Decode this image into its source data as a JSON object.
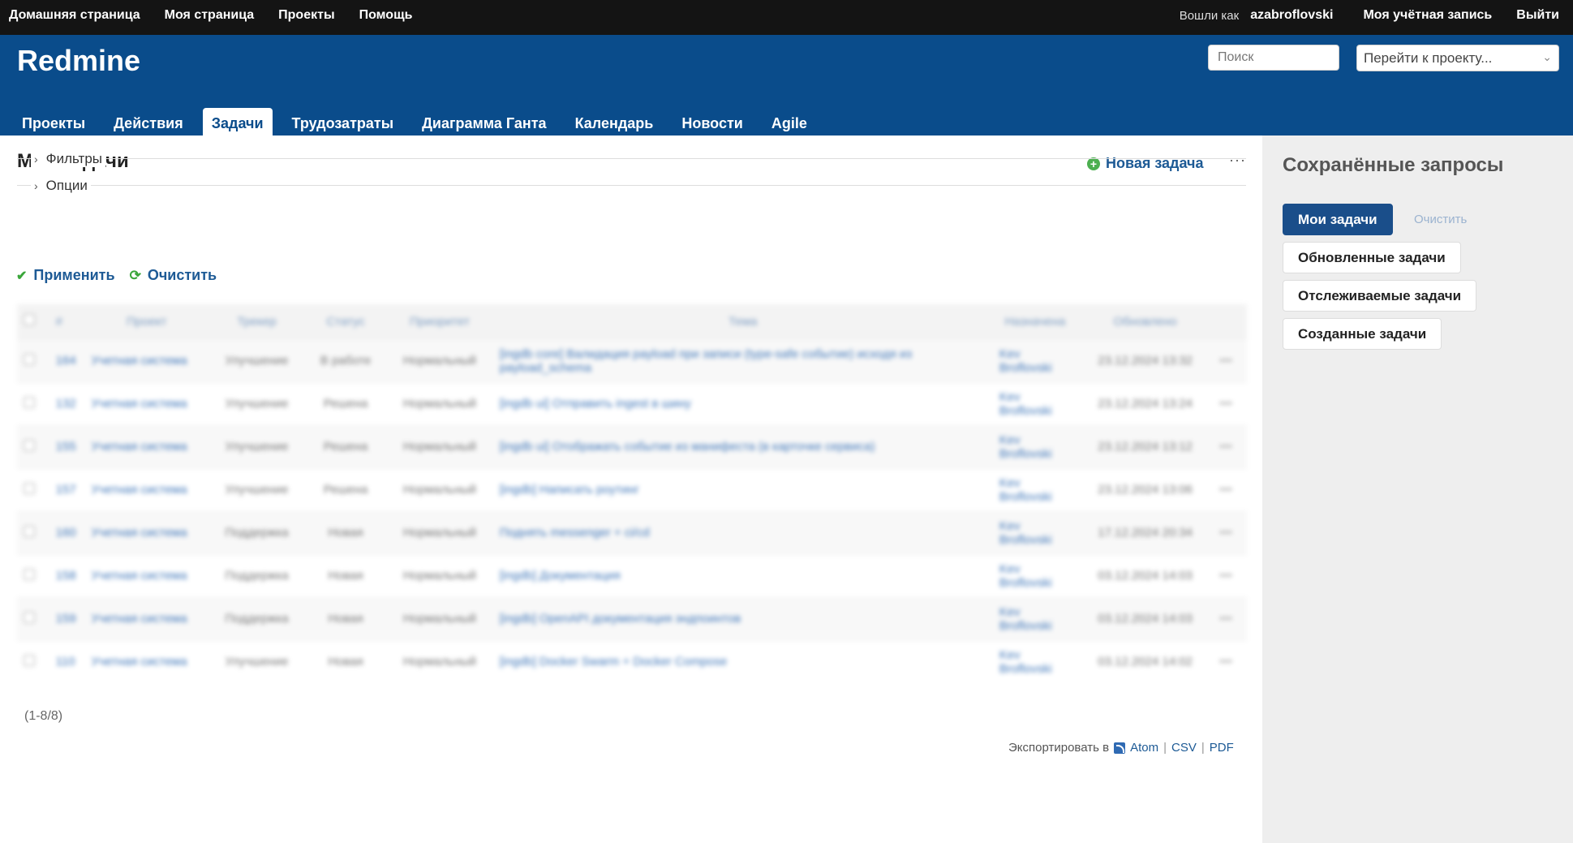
{
  "top_menu": {
    "left": [
      "Домашняя страница",
      "Моя страница",
      "Проекты",
      "Помощь"
    ],
    "logged_as": "Вошли как",
    "username": "azabroflovski",
    "account": "Моя учётная запись",
    "logout": "Выйти"
  },
  "header": {
    "title": "Redmine",
    "search_placeholder": "Поиск",
    "project_jump": "Перейти к проекту..."
  },
  "main_menu": {
    "tabs": [
      "Проекты",
      "Действия",
      "Задачи",
      "Трудозатраты",
      "Диаграмма Ганта",
      "Календарь",
      "Новости",
      "Agile"
    ],
    "selected": "Задачи"
  },
  "content": {
    "title": "Мои задачи",
    "new_issue": "Новая задача",
    "more": "···",
    "filters_label": "Фильтры",
    "options_label": "Опции",
    "apply": "Применить",
    "clear": "Очистить",
    "count": "(1-8/8)",
    "export_label": "Экспортировать в",
    "export_atom": "Atom",
    "export_csv": "CSV",
    "export_pdf": "PDF",
    "sep": "|"
  },
  "table": {
    "headers": [
      "#",
      "Проект",
      "Трекер",
      "Статус",
      "Приоритет",
      "Тема",
      "Назначена",
      "Обновлено"
    ],
    "rows": [
      [
        "164",
        "Учетная система",
        "Улучшение",
        "В работе",
        "Нормальный",
        "[ingdb core] Валидация payload при записи (type-safe событие) исходя из payload_schema",
        "Kev Broflovski",
        "23.12.2024 13:32"
      ],
      [
        "132",
        "Учетная система",
        "Улучшение",
        "Решена",
        "Нормальный",
        "[ingdb ui] Отправить ingest в шину",
        "Kev Broflovski",
        "23.12.2024 13:24"
      ],
      [
        "155",
        "Учетная система",
        "Улучшение",
        "Решена",
        "Нормальный",
        "[ingdb ui] Отображать событие из манифеста (в карточке сервиса)",
        "Kev Broflovski",
        "23.12.2024 13:12"
      ],
      [
        "157",
        "Учетная система",
        "Улучшение",
        "Решена",
        "Нормальный",
        "[ingdb] Написать роутинг",
        "Kev Broflovski",
        "23.12.2024 13:06"
      ],
      [
        "160",
        "Учетная система",
        "Поддержка",
        "Новая",
        "Нормальный",
        "Поднять messenger + ci/cd",
        "Kev Broflovski",
        "17.12.2024 20:34"
      ],
      [
        "158",
        "Учетная система",
        "Поддержка",
        "Новая",
        "Нормальный",
        "[ingdb] Документация",
        "Kev Broflovski",
        "03.12.2024 14:03"
      ],
      [
        "159",
        "Учетная система",
        "Поддержка",
        "Новая",
        "Нормальный",
        "[ingdb] OpenAPI документация эндпоинтов",
        "Kev Broflovski",
        "03.12.2024 14:03"
      ],
      [
        "110",
        "Учетная система",
        "Улучшение",
        "Новая",
        "Нормальный",
        "[ingdb] Docker Swarm + Docker Compose",
        "Kev Broflovski",
        "03.12.2024 14:02"
      ]
    ]
  },
  "sidebar": {
    "title": "Сохранённые запросы",
    "queries": [
      "Мои задачи",
      "Обновленные задачи",
      "Отслеживаемые задачи",
      "Созданные задачи"
    ],
    "selected": "Мои задачи",
    "clear": "Очистить"
  },
  "colors": {
    "header_bg": "#0a4c8b",
    "topbar_bg": "#141414",
    "link": "#1d5a95",
    "selected_query": "#1a4e8a",
    "sidebar_bg": "#eeeeee"
  }
}
